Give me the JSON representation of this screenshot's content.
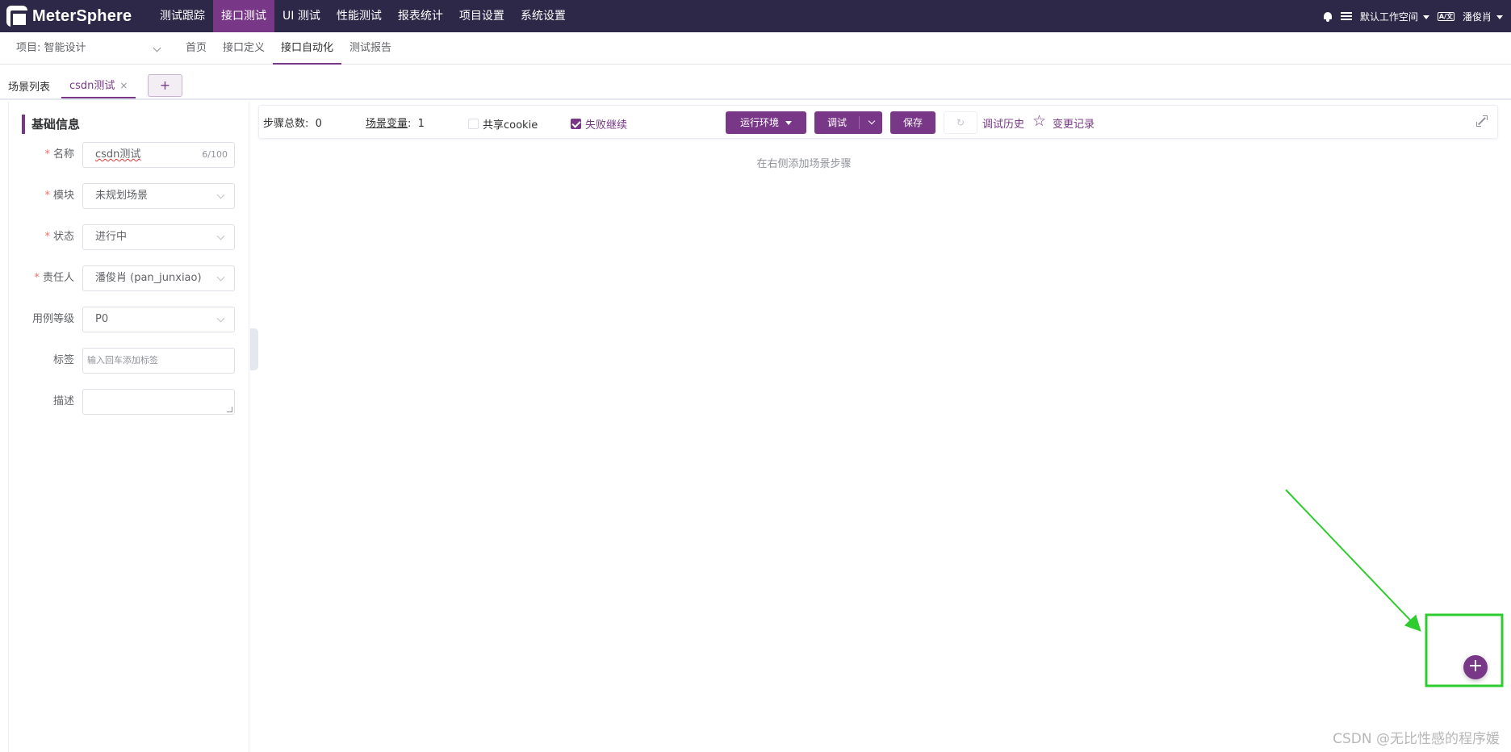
{
  "app": {
    "name": "MeterSphere"
  },
  "topnav": [
    {
      "label": "测试跟踪",
      "active": false
    },
    {
      "label": "接口测试",
      "active": true
    },
    {
      "label": "UI 测试",
      "active": false
    },
    {
      "label": "性能测试",
      "active": false
    },
    {
      "label": "报表统计",
      "active": false
    },
    {
      "label": "项目设置",
      "active": false
    },
    {
      "label": "系统设置",
      "active": false
    }
  ],
  "header_right": {
    "workspace": "默认工作空间",
    "user": "潘俊肖",
    "language_icon": "A/文"
  },
  "project": {
    "label": "项目: 智能设计"
  },
  "subnav": [
    {
      "label": "首页",
      "active": false
    },
    {
      "label": "接口定义",
      "active": false
    },
    {
      "label": "接口自动化",
      "active": true
    },
    {
      "label": "测试报告",
      "active": false
    }
  ],
  "tabs": {
    "list_label": "场景列表",
    "active_tab": "csdn测试",
    "close": "×",
    "add": "+"
  },
  "basic_info": {
    "title": "基础信息",
    "name": {
      "label": "名称",
      "value": "csdn测试",
      "count": "6/100"
    },
    "module": {
      "label": "模块",
      "value": "未规划场景"
    },
    "status": {
      "label": "状态",
      "value": "进行中"
    },
    "owner": {
      "label": "责任人",
      "value": "潘俊肖 (pan_junxiao)"
    },
    "level": {
      "label": "用例等级",
      "value": "P0"
    },
    "tags": {
      "label": "标签",
      "placeholder": "输入回车添加标签"
    },
    "desc": {
      "label": "描述",
      "value": ""
    },
    "required_mark": "*"
  },
  "toolbar": {
    "steps_total": "步骤总数:",
    "steps_value": "0",
    "scene_var": "场景变量",
    "scene_var_colon": ":",
    "scene_var_value": "1",
    "share_cookie": "共享cookie",
    "share_cookie_checked": false,
    "fail_continue": "失败继续",
    "fail_continue_checked": true,
    "run_env": "运行环境",
    "debug": "调试",
    "save": "保存",
    "debug_history": "调试历史",
    "change_log": "变更记录"
  },
  "empty_hint": "在右侧添加场景步骤",
  "fab": "+",
  "watermark": "CSDN @无比性感的程序媛",
  "colors": {
    "primary": "#783887",
    "header": "#2e2848",
    "annotation": "#2ecc2e"
  }
}
